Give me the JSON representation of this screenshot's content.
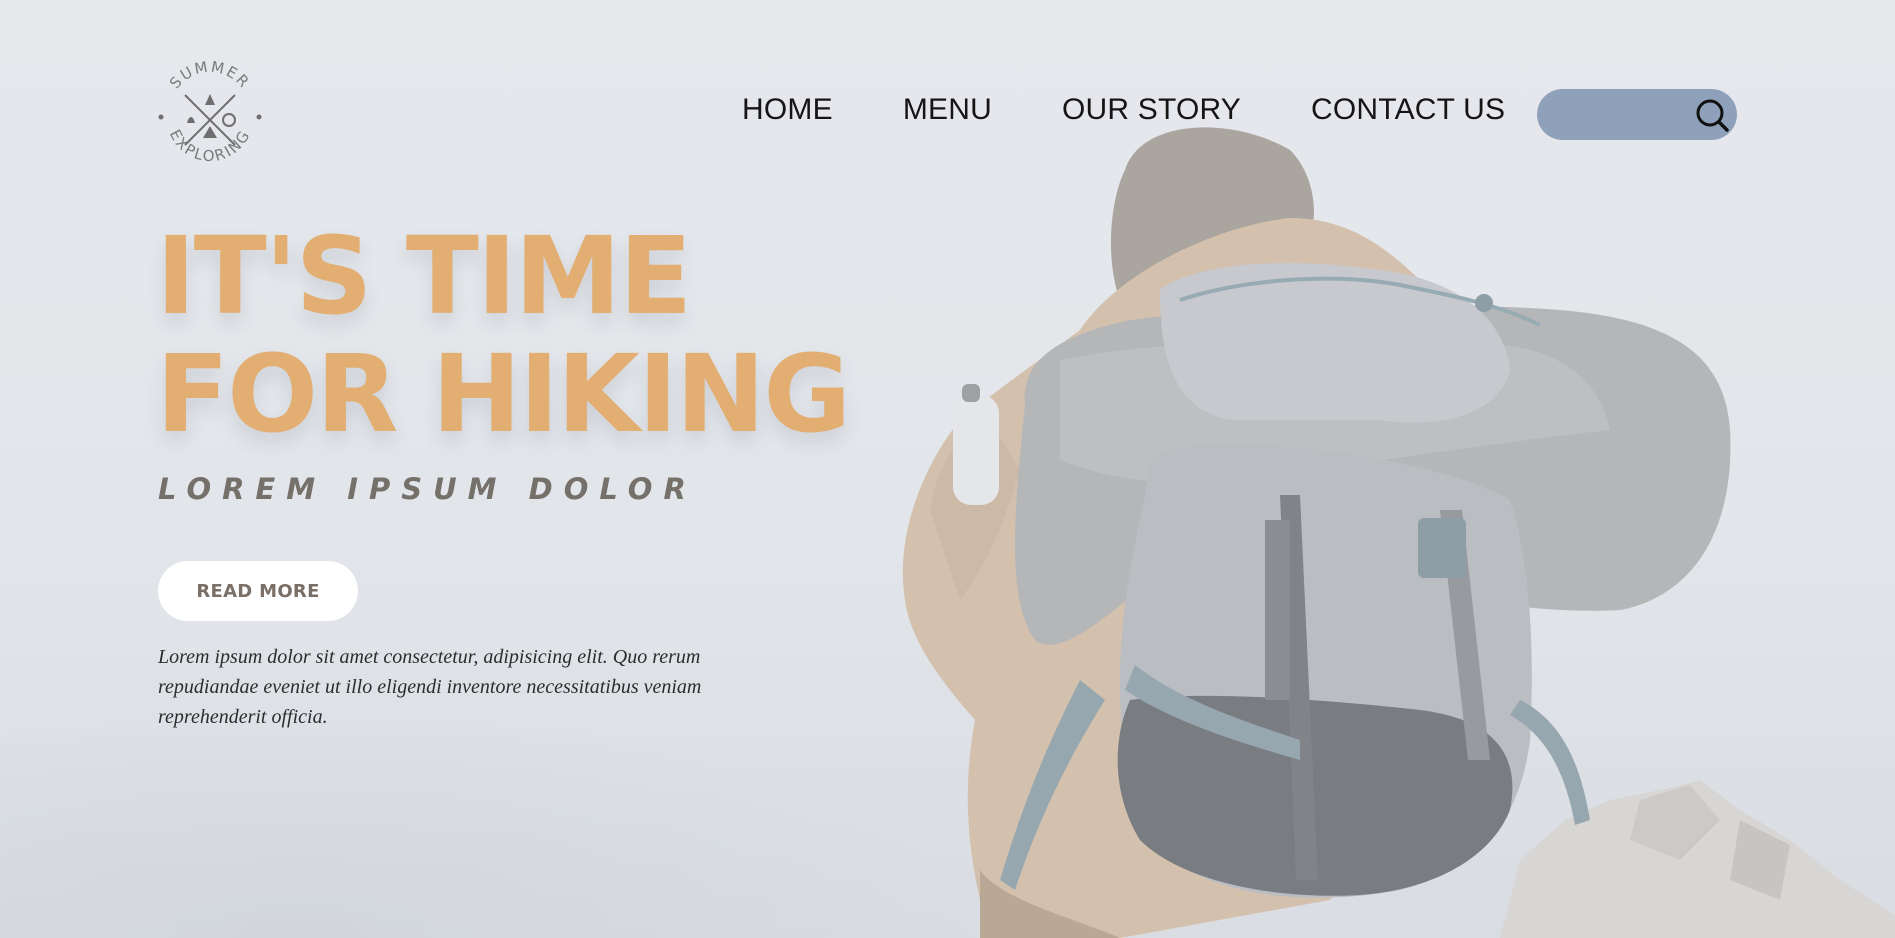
{
  "brand": {
    "logo_top_text": "SUMMER",
    "logo_bottom_text": "EXPLORING"
  },
  "nav": {
    "items": [
      {
        "label": "HOME"
      },
      {
        "label": "MENU"
      },
      {
        "label": "OUR STORY"
      },
      {
        "label": "CONTACT US"
      }
    ]
  },
  "search": {
    "value": "",
    "placeholder": "",
    "icon": "search-icon",
    "background": "#8fa1ba"
  },
  "hero": {
    "headline_line1": "IT'S TIME",
    "headline_line2": "FOR HIKING",
    "subheading": "LOREM IPSUM DOLOR",
    "cta_label": "READ MORE",
    "body": "Lorem ipsum dolor sit amet consectetur, adipisicing elit. Quo rerum repudiandae eveniet ut illo eligendi inventore necessitatibus veniam reprehenderit officia.",
    "headline_color": "#e2ae72",
    "subheading_color": "#75706a"
  }
}
